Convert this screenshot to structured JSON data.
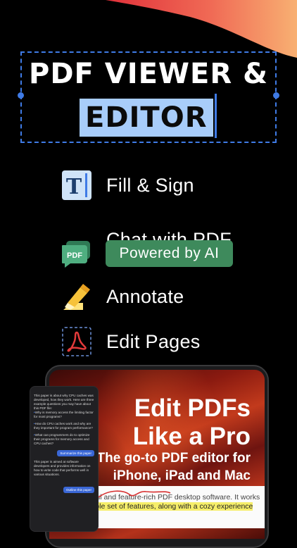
{
  "headline": {
    "line1": "PDF VIEWER &",
    "line2": "EDITOR"
  },
  "features": [
    {
      "label": "Fill & Sign",
      "icon": "text-t-icon"
    },
    {
      "label": "Chat with PDF",
      "icon": "pdf-chat-icon",
      "badge": "Powered by AI"
    },
    {
      "label": "Annotate",
      "icon": "highlighter-icon"
    },
    {
      "label": "Edit Pages",
      "icon": "acrobat-page-icon"
    }
  ],
  "promo": {
    "title_line1": "Edit PDFs",
    "title_line2": "Like a Pro",
    "subtitle_line1": "The go-to PDF editor for",
    "subtitle_line2": "iPhone, iPad and Mac"
  },
  "document": {
    "line1": "s a beautiful and feature-rich PDF desktop software. It works",
    "line2": "rful & reliable set of features, along with a cozy experience"
  },
  "chat": {
    "intro": "This paper is about why CPU caches was developed, how they work. Here are three example questions you may have about this PDF file:",
    "q1": "Why is memory access the limiting factor for most programs?",
    "q2": "How do CPU caches work and why are they important for program performance?",
    "q3": "What can programmers do to optimize their programs for memory access and CPU caches?",
    "summarize_button": "Summarize this paper",
    "answer": "This paper is aimed at software developers and provides information on how to write code that performs well in various situations.",
    "outline_button": "Outline this paper"
  },
  "colors": {
    "accent_blue": "#3f7be6",
    "highlight": "#a8cdfa",
    "ai_badge": "#3e8a5c",
    "swoosh_start": "#e8383a",
    "swoosh_end": "#f7a86b"
  }
}
